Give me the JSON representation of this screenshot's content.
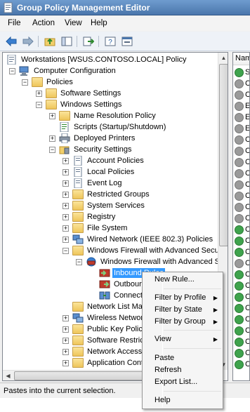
{
  "window": {
    "title": "Group Policy Management Editor"
  },
  "menu": [
    "File",
    "Action",
    "View",
    "Help"
  ],
  "toolbar": {
    "icons": [
      "back-arrow-icon",
      "forward-arrow-icon",
      "up-folder-icon",
      "show-hide-tree-icon",
      "export-list-icon",
      "help-icon",
      "properties-icon"
    ]
  },
  "tree": {
    "rows": [
      {
        "label": "Workstations [WSUS.CONTOSO.LOCAL] Policy",
        "icon": "policy-icon"
      },
      {
        "label": "Computer Configuration",
        "icon": "computer-icon"
      },
      {
        "label": "Policies",
        "icon": "folder-icon"
      },
      {
        "label": "Software Settings",
        "icon": "folder-icon"
      },
      {
        "label": "Windows Settings",
        "icon": "folder-icon"
      },
      {
        "label": "Name Resolution Policy",
        "icon": "folder-icon"
      },
      {
        "label": "Scripts (Startup/Shutdown)",
        "icon": "script-icon"
      },
      {
        "label": "Deployed Printers",
        "icon": "printer-icon"
      },
      {
        "label": "Security Settings",
        "icon": "security-icon"
      },
      {
        "label": "Account Policies",
        "icon": "policy-icon"
      },
      {
        "label": "Local Policies",
        "icon": "policy-icon"
      },
      {
        "label": "Event Log",
        "icon": "policy-icon"
      },
      {
        "label": "Restricted Groups",
        "icon": "folder-icon"
      },
      {
        "label": "System Services",
        "icon": "folder-icon"
      },
      {
        "label": "Registry",
        "icon": "folder-icon"
      },
      {
        "label": "File System",
        "icon": "folder-icon"
      },
      {
        "label": "Wired Network (IEEE 802.3) Policies",
        "icon": "network-icon"
      },
      {
        "label": "Windows Firewall with Advanced Secu",
        "icon": "folder-icon"
      },
      {
        "label": "Windows Firewall with Advanced S",
        "icon": "firewall-icon"
      },
      {
        "label": "Inbound Rules",
        "icon": "inbound-rules-icon"
      },
      {
        "label": "Outbour",
        "icon": "outbound-rules-icon"
      },
      {
        "label": "Connect",
        "icon": "connection-rules-icon"
      },
      {
        "label": "Network List Ma",
        "icon": "folder-icon"
      },
      {
        "label": "Wireless Networ",
        "icon": "network-icon"
      },
      {
        "label": "Public Key Policie",
        "icon": "folder-icon"
      },
      {
        "label": "Software Restric",
        "icon": "folder-icon"
      },
      {
        "label": "Network Access",
        "icon": "folder-icon"
      },
      {
        "label": "Application Cont",
        "icon": "folder-icon"
      }
    ]
  },
  "right_pane": {
    "column_header": "Nam",
    "rows": [
      {
        "text": "S",
        "status": "enabled"
      },
      {
        "text": "C",
        "status": "disabled"
      },
      {
        "text": "C",
        "status": "disabled"
      },
      {
        "text": "E",
        "status": "disabled"
      },
      {
        "text": "E",
        "status": "disabled"
      },
      {
        "text": "E",
        "status": "disabled"
      },
      {
        "text": "C",
        "status": "disabled"
      },
      {
        "text": "C",
        "status": "disabled"
      },
      {
        "text": "C",
        "status": "disabled"
      },
      {
        "text": "C",
        "status": "disabled"
      },
      {
        "text": "C",
        "status": "disabled"
      },
      {
        "text": "C",
        "status": "disabled"
      },
      {
        "text": "C",
        "status": "disabled"
      },
      {
        "text": "C",
        "status": "disabled"
      },
      {
        "text": "C",
        "status": "enabled"
      },
      {
        "text": "C",
        "status": "enabled"
      },
      {
        "text": "C",
        "status": "enabled"
      },
      {
        "text": "C",
        "status": "disabled"
      },
      {
        "text": "C",
        "status": "enabled"
      },
      {
        "text": "C",
        "status": "enabled"
      },
      {
        "text": "C",
        "status": "enabled"
      },
      {
        "text": "C",
        "status": "enabled"
      },
      {
        "text": "C",
        "status": "enabled"
      },
      {
        "text": "C",
        "status": "enabled"
      },
      {
        "text": "C",
        "status": "enabled"
      },
      {
        "text": "C",
        "status": "enabled"
      },
      {
        "text": "C",
        "status": "enabled"
      }
    ]
  },
  "context_menu": {
    "items": [
      {
        "label": "New Rule...",
        "submenu": false
      },
      {
        "label": "Filter by Profile",
        "submenu": true
      },
      {
        "label": "Filter by State",
        "submenu": true
      },
      {
        "label": "Filter by Group",
        "submenu": true
      },
      {
        "label": "View",
        "submenu": true
      },
      {
        "label": "Paste",
        "submenu": false
      },
      {
        "label": "Refresh",
        "submenu": false
      },
      {
        "label": "Export List...",
        "submenu": false
      },
      {
        "label": "Help",
        "submenu": false
      }
    ]
  },
  "status": {
    "text": "Pastes into the current selection."
  },
  "colors": {
    "title_bar": "#4a76ab",
    "selection": "#3399ff",
    "enabled_rule": "#3fa34d",
    "disabled_rule": "#9a9a9a"
  }
}
